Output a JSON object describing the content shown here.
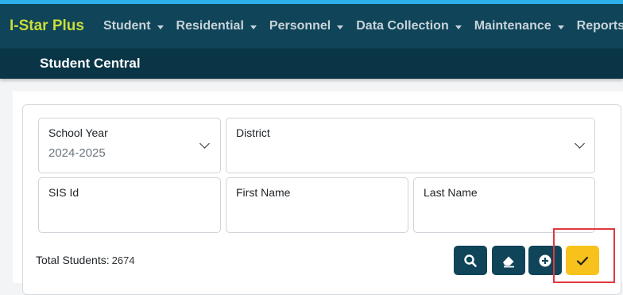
{
  "app": {
    "brand": "I-Star Plus",
    "accent_color": "#c9dc3a",
    "nav_color": "#0f4459",
    "nav_items": [
      {
        "label": "Student"
      },
      {
        "label": "Residential"
      },
      {
        "label": "Personnel"
      },
      {
        "label": "Data Collection"
      },
      {
        "label": "Maintenance"
      },
      {
        "label": "Reports"
      }
    ]
  },
  "page": {
    "title": "Student Central"
  },
  "form": {
    "school_year": {
      "label": "School Year",
      "value": "2024-2025"
    },
    "district": {
      "label": "District",
      "value": ""
    },
    "sis_id": {
      "label": "SIS Id",
      "value": ""
    },
    "first_name": {
      "label": "First Name",
      "value": ""
    },
    "last_name": {
      "label": "Last Name",
      "value": ""
    }
  },
  "summary": {
    "total_label": "Total Students:",
    "total_count": "2674"
  },
  "actions": [
    {
      "name": "search-button",
      "icon": "search-icon"
    },
    {
      "name": "clear-button",
      "icon": "eraser-icon"
    },
    {
      "name": "add-button",
      "icon": "plus-circle-icon"
    },
    {
      "name": "confirm-button",
      "icon": "check-icon",
      "color": "#f7c21b"
    }
  ]
}
